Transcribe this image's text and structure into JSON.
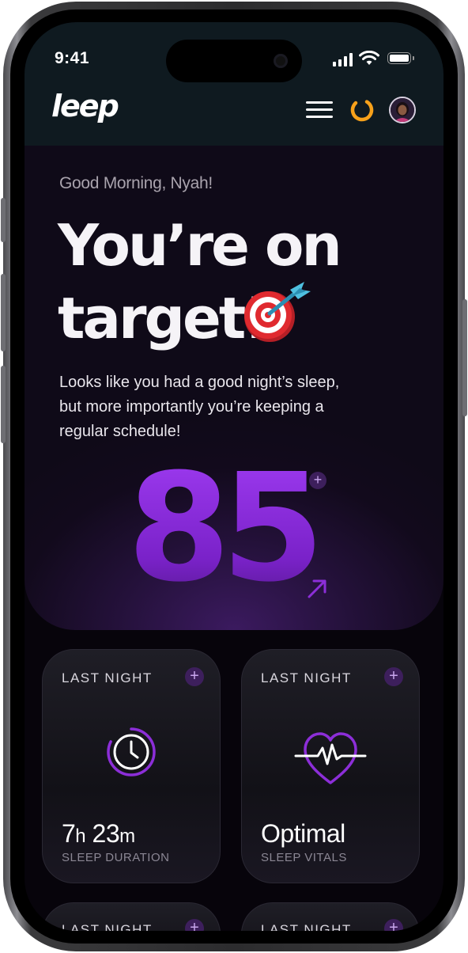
{
  "status_bar": {
    "time": "9:41"
  },
  "header": {
    "logo": "leep",
    "accent_color": "#f7a11a"
  },
  "hero": {
    "greeting": "Good Morning, Nyah!",
    "headline_line1": "You’re on",
    "headline_line2": "target!",
    "description": "Looks like you had a good night’s sleep, but more importantly you’re keeping a regular schedule!",
    "score": "85",
    "score_plus": "+",
    "score_color": "#8c2ed8"
  },
  "cards": [
    {
      "label": "LAST NIGHT",
      "plus": "+",
      "value_num1": "7",
      "value_unit1": "h",
      "value_num2": " 23",
      "value_unit2": "m",
      "sub": "SLEEP DURATION",
      "icon": "clock-icon"
    },
    {
      "label": "LAST NIGHT",
      "plus": "+",
      "value": "Optimal",
      "sub": "SLEEP VITALS",
      "icon": "heart-pulse-icon"
    },
    {
      "label": "LAST NIGHT",
      "plus": "+"
    },
    {
      "label": "LAST NIGHT",
      "plus": "+"
    }
  ]
}
